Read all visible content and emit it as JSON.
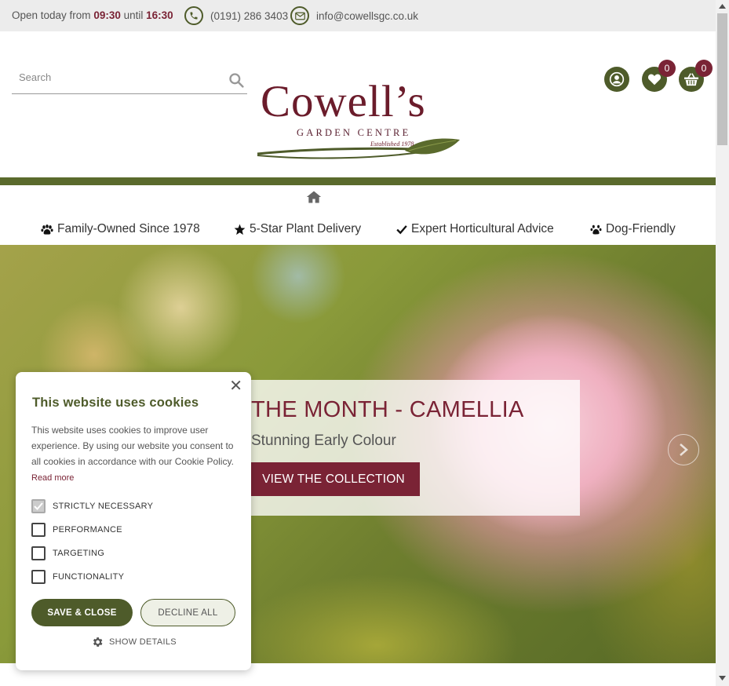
{
  "topbar": {
    "hours_prefix": "Open today from",
    "open_time": "09:30",
    "hours_middle": "until",
    "close_time": "16:30",
    "phone": "(0191) 286 3403",
    "email": "info@cowellsgc.co.uk"
  },
  "header": {
    "search_placeholder": "Search",
    "logo_word": "Cowell’s",
    "logo_sub": "GARDEN CENTRE",
    "logo_est": "Established 1978",
    "wishlist_count": "0",
    "basket_count": "0"
  },
  "usps": [
    {
      "label": "Family-Owned Since 1978",
      "icon": "paw-icon"
    },
    {
      "label": "5-Star Plant Delivery",
      "icon": "star-icon"
    },
    {
      "label": "Expert Horticultural Advice",
      "icon": "check-icon"
    },
    {
      "label": "Dog-Friendly",
      "icon": "paw-icon"
    }
  ],
  "hero": {
    "title": "THE MONTH - CAMELLIA",
    "subtitle": "Stunning Early Colour",
    "button": "VIEW THE COLLECTION"
  },
  "cookie": {
    "title": "This website uses cookies",
    "description": "This website uses cookies to improve user experience. By using our website you consent to all cookies in accordance with our Cookie Policy.",
    "read_more": "Read more",
    "options": [
      {
        "label": "STRICTLY NECESSARY",
        "checked": true,
        "disabled": true
      },
      {
        "label": "PERFORMANCE",
        "checked": false
      },
      {
        "label": "TARGETING",
        "checked": false
      },
      {
        "label": "FUNCTIONALITY",
        "checked": false
      }
    ],
    "save_label": "SAVE & CLOSE",
    "decline_label": "DECLINE ALL",
    "details_label": "SHOW DETAILS"
  },
  "colors": {
    "brand_green": "#4e5b2a",
    "brand_maroon": "#7a2335"
  }
}
